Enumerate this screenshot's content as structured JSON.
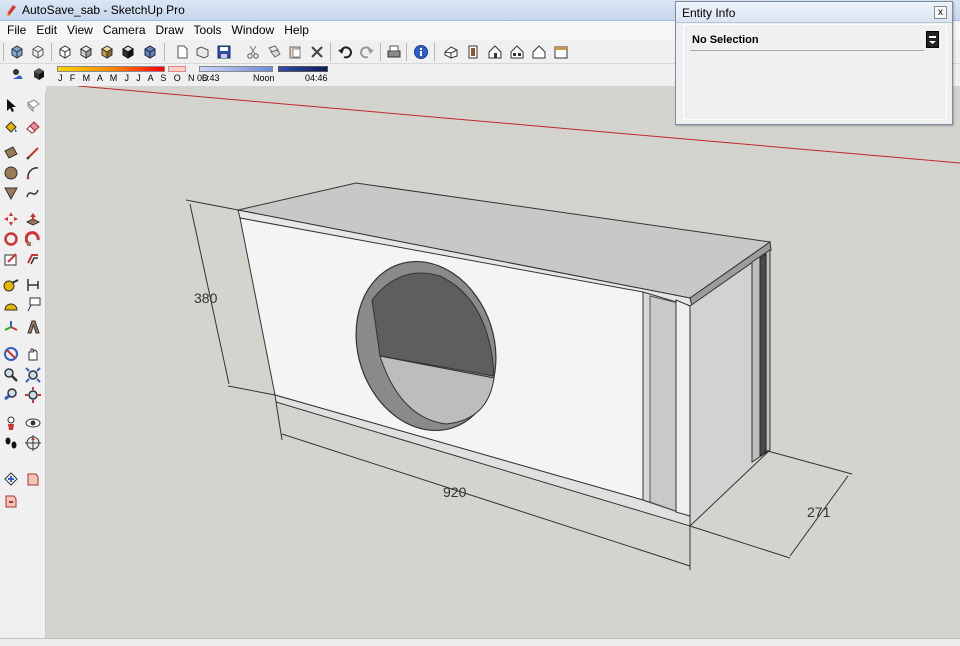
{
  "window": {
    "title": "AutoSave_sab - SketchUp Pro",
    "title_obscured": "..."
  },
  "menu": {
    "items": [
      "File",
      "Edit",
      "View",
      "Camera",
      "Draw",
      "Tools",
      "Window",
      "Help"
    ]
  },
  "shadow_toolbar": {
    "months": "J F M A M J J A S O N D",
    "time_start": "06:43",
    "time_mid": "Noon",
    "time_end": "04:46"
  },
  "entity_info": {
    "title": "Entity Info",
    "close": "x",
    "selection": "No Selection"
  },
  "model": {
    "dim_height": "380",
    "dim_width": "920",
    "dim_depth": "271"
  },
  "icons": {
    "toolbar_top": [
      "xray-box-icon",
      "wireframe-box-icon",
      "hidden-line-box-icon",
      "shaded-box-icon",
      "textured-box-icon",
      "monochrome-box-icon",
      "new-icon",
      "open-icon",
      "save-icon",
      "cut-icon",
      "copy-icon",
      "paste-icon",
      "erase-icon",
      "undo-icon",
      "redo-icon",
      "print-icon",
      "model-info-icon",
      "iso-view-icon",
      "top-view-icon",
      "front-view-icon",
      "right-view-icon",
      "back-view-icon",
      "left-view-icon"
    ],
    "toolbar_shadow": [
      "shadow-settings-icon",
      "display-shadows-icon"
    ],
    "palette": [
      "select-icon",
      "make-component-icon",
      "paint-bucket-icon",
      "eraser-icon",
      "rectangle-icon",
      "line-icon",
      "circle-icon",
      "arc-icon",
      "polygon-icon",
      "freehand-icon",
      "move-icon",
      "push-pull-icon",
      "rotate-icon",
      "follow-me-icon",
      "scale-icon",
      "offset-icon",
      "tape-measure-icon",
      "dimension-icon",
      "protractor-icon",
      "text-icon",
      "axes-icon",
      "3d-text-icon",
      "orbit-icon",
      "pan-icon",
      "zoom-icon",
      "zoom-window-icon",
      "previous-view-icon",
      "zoom-extents-icon",
      "position-camera-icon",
      "look-around-icon",
      "walk-icon",
      "section-plane-icon",
      "warehouse-icon",
      "get-models-icon",
      "share-model-icon"
    ]
  },
  "colors": {
    "viewport_bg": "#d4d4ce",
    "red_axis": "#c0282a",
    "titlebar": "#c6d6ec"
  }
}
